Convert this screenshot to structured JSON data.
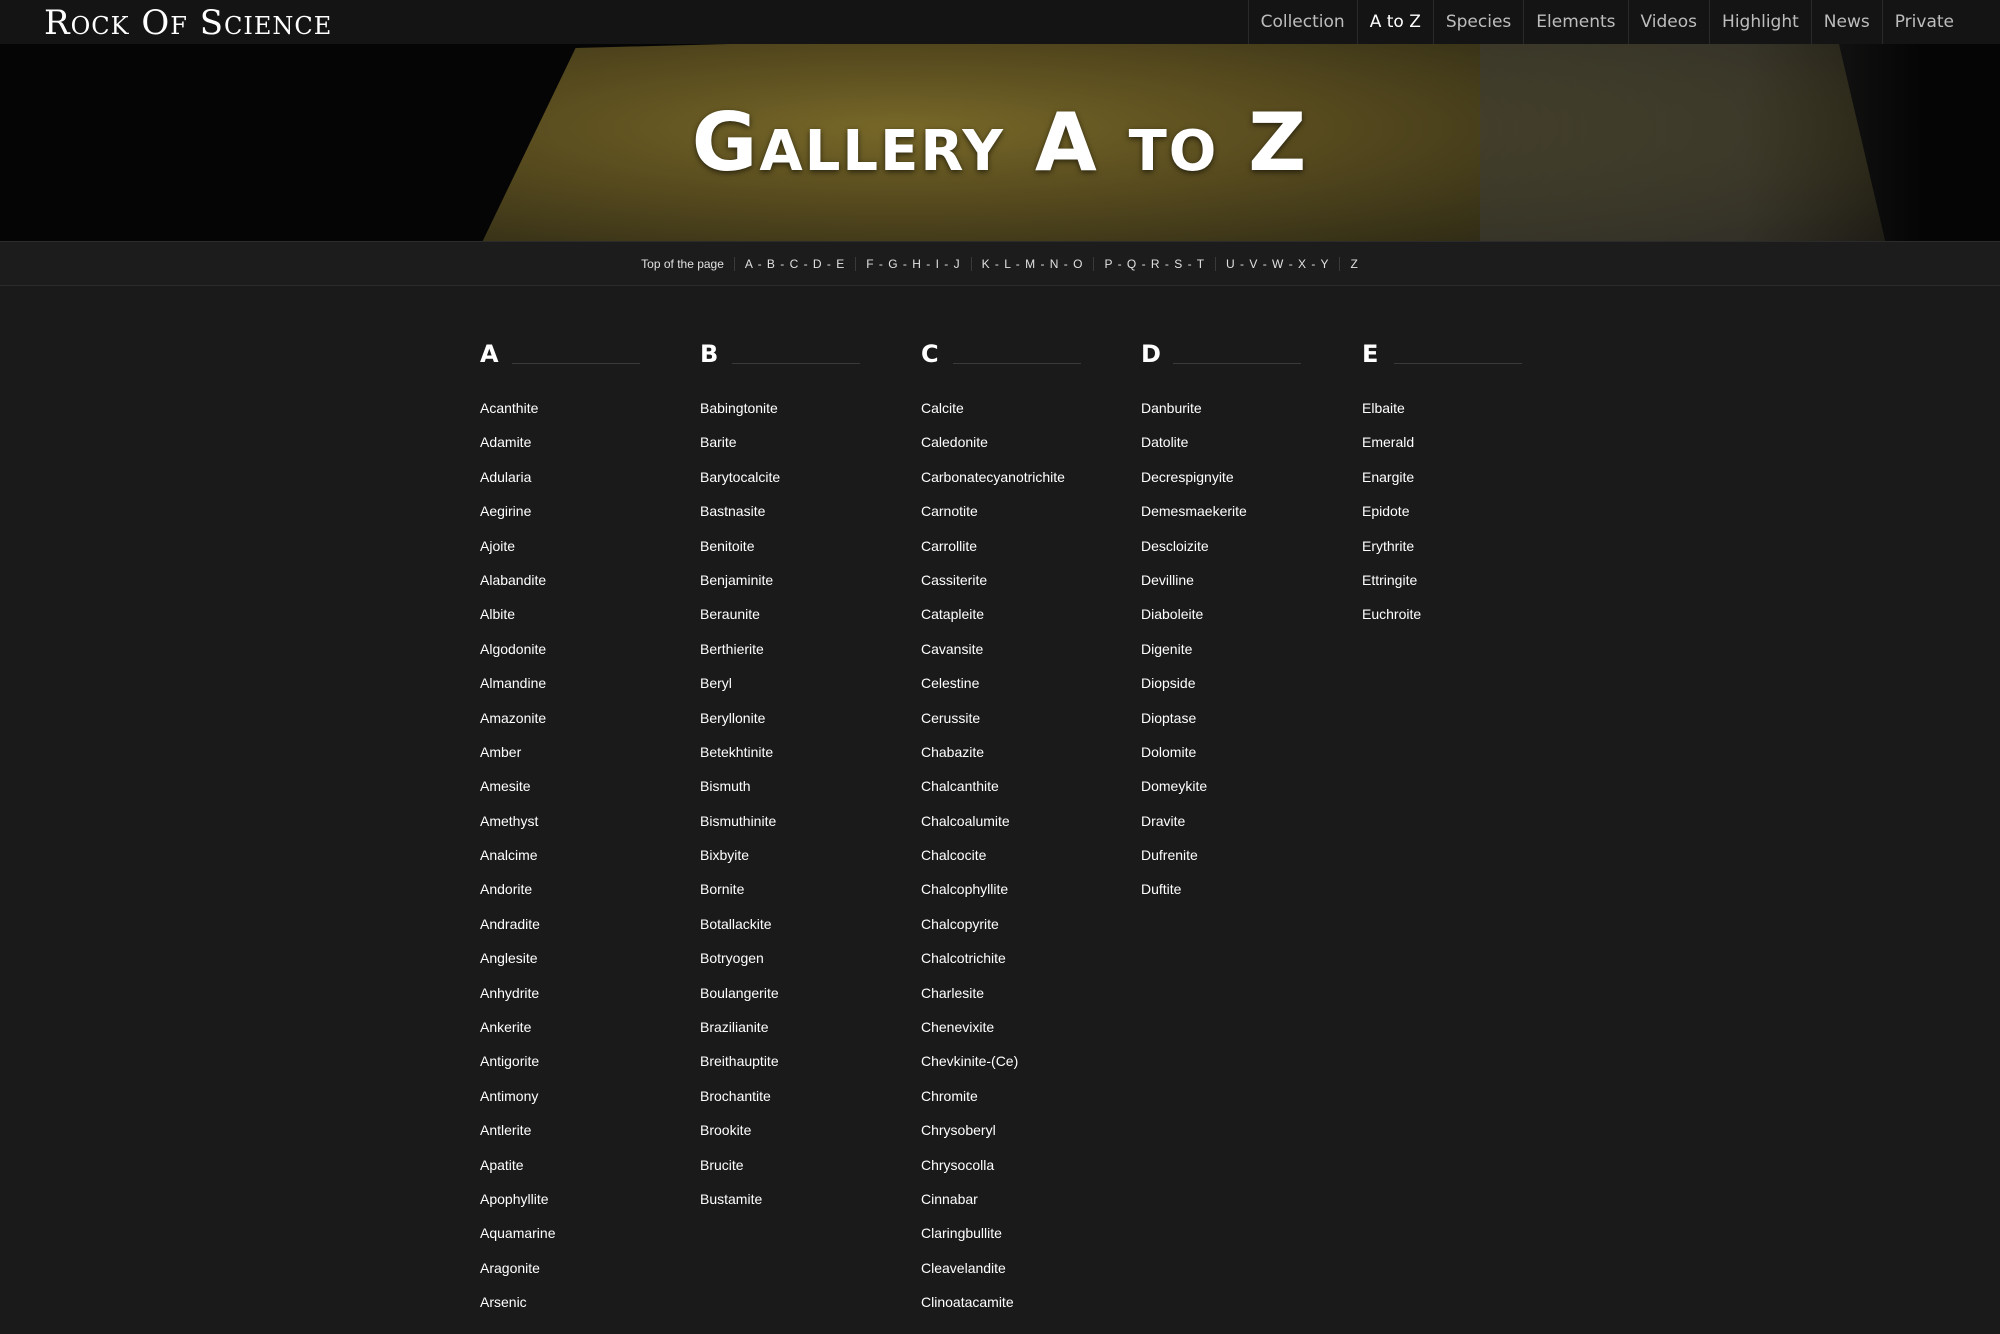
{
  "site": {
    "logo": "Rock Of Science"
  },
  "nav": [
    {
      "label": "Collection",
      "active": false
    },
    {
      "label": "A to Z",
      "active": true
    },
    {
      "label": "Species",
      "active": false
    },
    {
      "label": "Elements",
      "active": false
    },
    {
      "label": "Videos",
      "active": false
    },
    {
      "label": "Highlight",
      "active": false
    },
    {
      "label": "News",
      "active": false
    },
    {
      "label": "Private",
      "active": false
    }
  ],
  "hero": {
    "title": "Gallery A to Z"
  },
  "letter_nav": [
    "Top of the page",
    "A - B - C - D - E",
    "F - G - H - I - J",
    "K - L - M - N - O",
    "P - Q - R - S - T",
    "U - V - W - X - Y",
    "Z"
  ],
  "columns": [
    {
      "letter": "A",
      "items": [
        "Acanthite",
        "Adamite",
        "Adularia",
        "Aegirine",
        "Ajoite",
        "Alabandite",
        "Albite",
        "Algodonite",
        "Almandine",
        "Amazonite",
        "Amber",
        "Amesite",
        "Amethyst",
        "Analcime",
        "Andorite",
        "Andradite",
        "Anglesite",
        "Anhydrite",
        "Ankerite",
        "Antigorite",
        "Antimony",
        "Antlerite",
        "Apatite",
        "Apophyllite",
        "Aquamarine",
        "Aragonite",
        "Arsenic"
      ]
    },
    {
      "letter": "B",
      "items": [
        "Babingtonite",
        "Barite",
        "Barytocalcite",
        "Bastnasite",
        "Benitoite",
        "Benjaminite",
        "Beraunite",
        "Berthierite",
        "Beryl",
        "Beryllonite",
        "Betekhtinite",
        "Bismuth",
        "Bismuthinite",
        "Bixbyite",
        "Bornite",
        "Botallackite",
        "Botryogen",
        "Boulangerite",
        "Brazilianite",
        "Breithauptite",
        "Brochantite",
        "Brookite",
        "Brucite",
        "Bustamite"
      ]
    },
    {
      "letter": "C",
      "items": [
        "Calcite",
        "Caledonite",
        "Carbonatecyanotrichite",
        "Carnotite",
        "Carrollite",
        "Cassiterite",
        "Catapleite",
        "Cavansite",
        "Celestine",
        "Cerussite",
        "Chabazite",
        "Chalcanthite",
        "Chalcoalumite",
        "Chalcocite",
        "Chalcophyllite",
        "Chalcopyrite",
        "Chalcotrichite",
        "Charlesite",
        "Chenevixite",
        "Chevkinite-(Ce)",
        "Chromite",
        "Chrysoberyl",
        "Chrysocolla",
        "Cinnabar",
        "Claringbullite",
        "Cleavelandite",
        "Clinoatacamite"
      ]
    },
    {
      "letter": "D",
      "items": [
        "Danburite",
        "Datolite",
        "Decrespignyite",
        "Demesmaekerite",
        "Descloizite",
        "Devilline",
        "Diaboleite",
        "Digenite",
        "Diopside",
        "Dioptase",
        "Dolomite",
        "Domeykite",
        "Dravite",
        "Dufrenite",
        "Duftite"
      ]
    },
    {
      "letter": "E",
      "items": [
        "Elbaite",
        "Emerald",
        "Enargite",
        "Epidote",
        "Erythrite",
        "Ettringite",
        "Euchroite"
      ]
    }
  ]
}
